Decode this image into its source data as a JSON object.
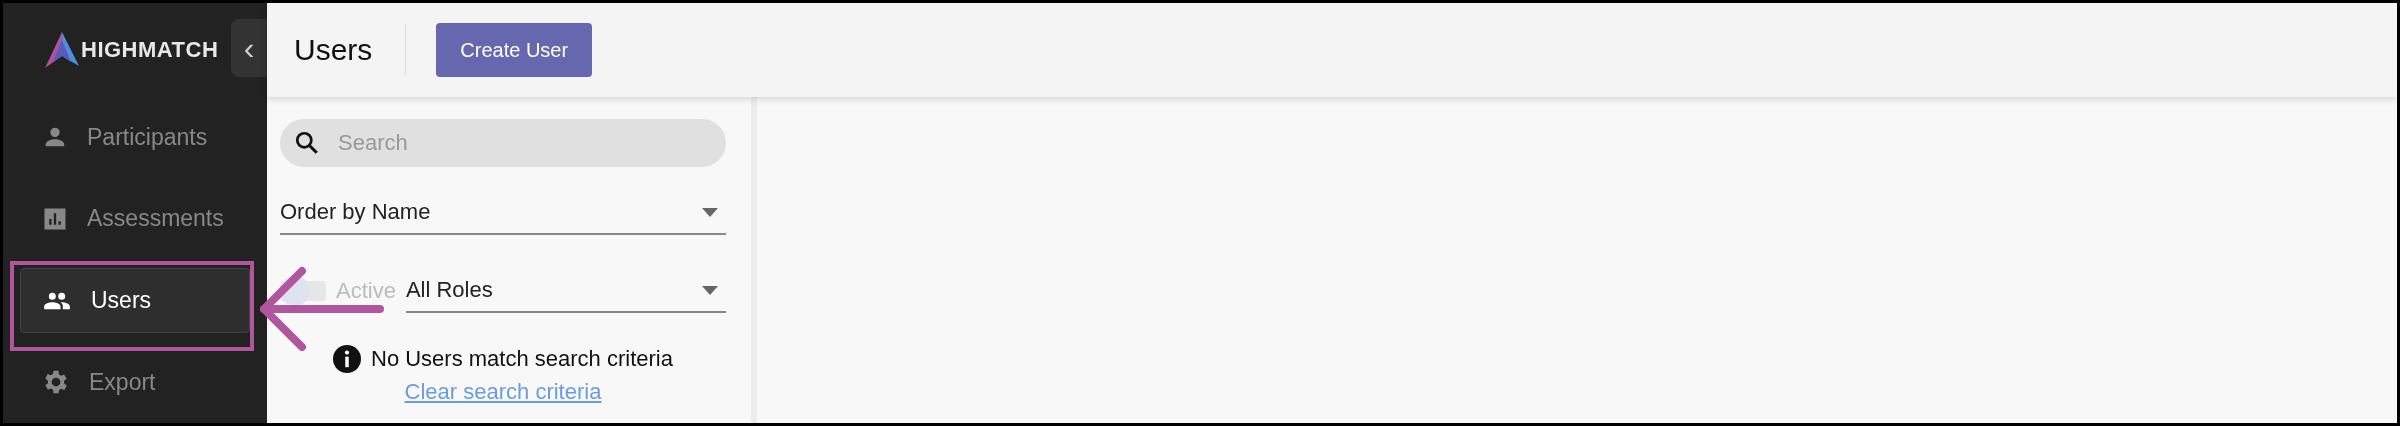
{
  "sidebar": {
    "logo": "HIGHMATCH",
    "collapse": "‹",
    "items": [
      {
        "label": "Participants",
        "kind": "person",
        "selected": false
      },
      {
        "label": "Assessments",
        "kind": "chart",
        "selected": false
      },
      {
        "label": "Users",
        "kind": "people",
        "selected": true
      },
      {
        "label": "Export",
        "kind": "gear",
        "selected": false
      }
    ]
  },
  "header": {
    "title": "Users",
    "button": "Create User"
  },
  "filters": {
    "search": {
      "placeholder": "Search"
    },
    "order": {
      "value": "Order by Name"
    },
    "active_toggle": {
      "label": "Active",
      "on": false,
      "disabled": true
    },
    "roles": {
      "value": "All Roles"
    }
  },
  "empty": {
    "message": "No Users match search criteria",
    "link": "Clear search criteria"
  }
}
